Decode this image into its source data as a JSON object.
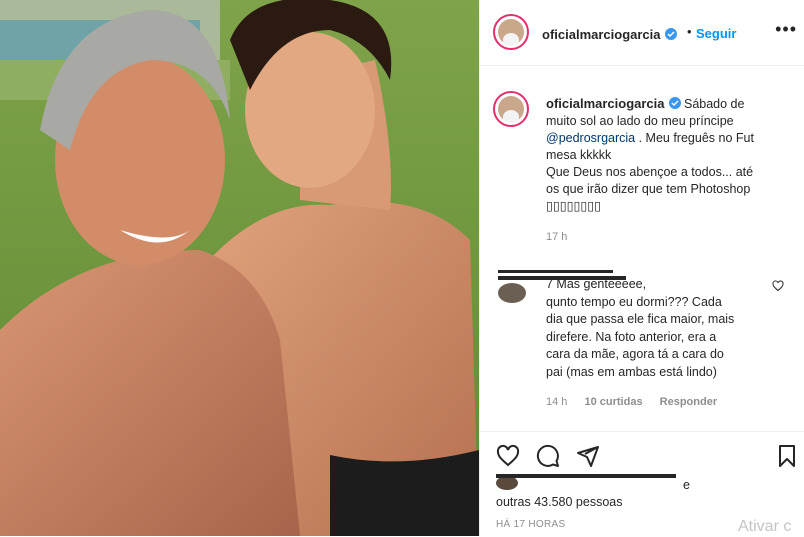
{
  "post": {
    "username": "oficialmarciogarcia",
    "follow_label": "Seguir",
    "more_label": "•••",
    "caption_lines": [
      "Sábado de",
      "muito sol ao lado do meu príncipe",
      "@pedrosrgarcia",
      " . Meu freguês no Fut",
      "mesa kkkkk",
      "Que Deus nos abençoe a todos... até",
      "os que irão dizer que tem Photoshop",
      "▯▯▯▯▯▯▯▯"
    ],
    "caption_time": "17 h"
  },
  "comment": {
    "text_lines": [
      "7 Mas genteeeee,",
      "qunto tempo eu dormi??? Cada",
      "dia que passa ele fica maior, mais",
      "direfere. Na foto anterior, era a",
      "cara da mãe, agora tá a cara do",
      "pai (mas em ambas está lindo)"
    ],
    "time": "14 h",
    "likes": "10 curtidas",
    "reply": "Responder"
  },
  "footer": {
    "likes_suffix": "e",
    "likes_line": "outras 43.580 pessoas",
    "date": "HÁ 17 HORAS",
    "watermark": "Ativar c"
  },
  "icons": [
    "verified-badge-icon",
    "heart-icon",
    "comment-icon",
    "share-icon",
    "bookmark-icon",
    "comment-heart-icon"
  ]
}
